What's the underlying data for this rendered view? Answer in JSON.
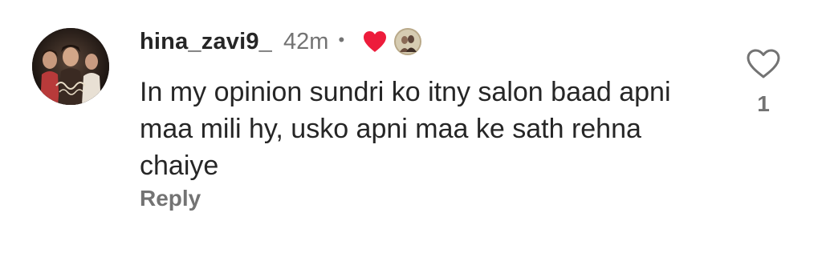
{
  "comment": {
    "username": "hina_zavi9_",
    "timestamp": "42m",
    "separator": "•",
    "creator_liked_icon": "heart-filled-icon",
    "heart_color": "#ed1c3b",
    "text": "In my opinion sundri ko itny salon baad apni maa mili hy, usko apni maa ke sath rehna chaiye",
    "reply_label": "Reply",
    "like_icon": "heart-outline-icon",
    "like_count": "1"
  },
  "colors": {
    "primary_text": "#262626",
    "secondary_text": "#737373",
    "background": "#ffffff"
  }
}
